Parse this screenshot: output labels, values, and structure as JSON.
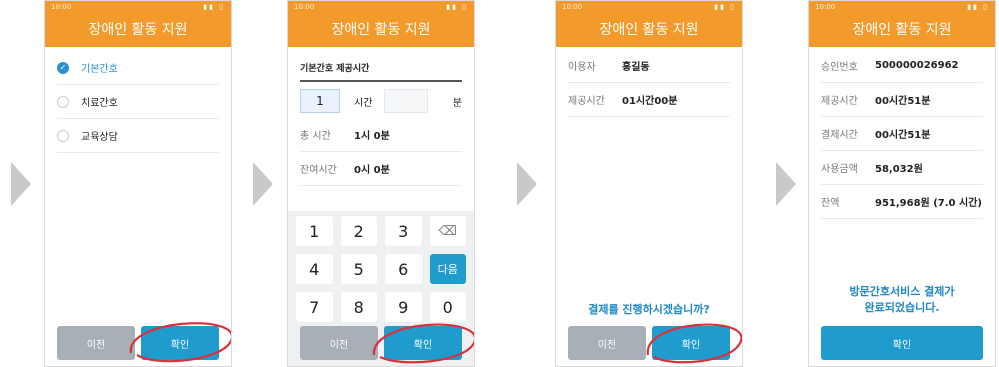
{
  "app_title": "장애인 활동 지원",
  "status_time": "10:00",
  "buttons": {
    "prev": "이전",
    "confirm": "확인"
  },
  "screen1": {
    "options": [
      {
        "label": "기본간호",
        "selected": true
      },
      {
        "label": "치료간호",
        "selected": false
      },
      {
        "label": "교육상담",
        "selected": false
      }
    ]
  },
  "screen2": {
    "section_title": "기본간호 제공시간",
    "hour_value": "1",
    "hour_unit": "시간",
    "minute_value": "",
    "minute_unit": "분",
    "total_label": "총 시간",
    "total_value": "1시 0분",
    "remaining_label": "잔여시간",
    "remaining_value": "0시 0분",
    "keys": [
      "1",
      "2",
      "3",
      "⌫",
      "4",
      "5",
      "6",
      "다음",
      "7",
      "8",
      "9",
      "0"
    ]
  },
  "screen3": {
    "user_label": "이용자",
    "user_value": "홍길동",
    "time_label": "제공시간",
    "time_value": "01시간00분",
    "prompt": "결제를 진행하시겠습니까?"
  },
  "screen4": {
    "rows": [
      {
        "label": "승인번호",
        "value": "500000026962"
      },
      {
        "label": "제공시간",
        "value": "00시간51분"
      },
      {
        "label": "결제시간",
        "value": "00시간51분"
      },
      {
        "label": "사용금액",
        "value": "58,032원"
      },
      {
        "label": "잔액",
        "value": "951,968원 (7.0 시간)"
      }
    ],
    "done_line1": "방문간호서비스 결제가",
    "done_line2": "완료되었습니다."
  },
  "colors": {
    "accent": "#f39a2d",
    "primary": "#1f9bce",
    "highlight": "#d8333a"
  }
}
